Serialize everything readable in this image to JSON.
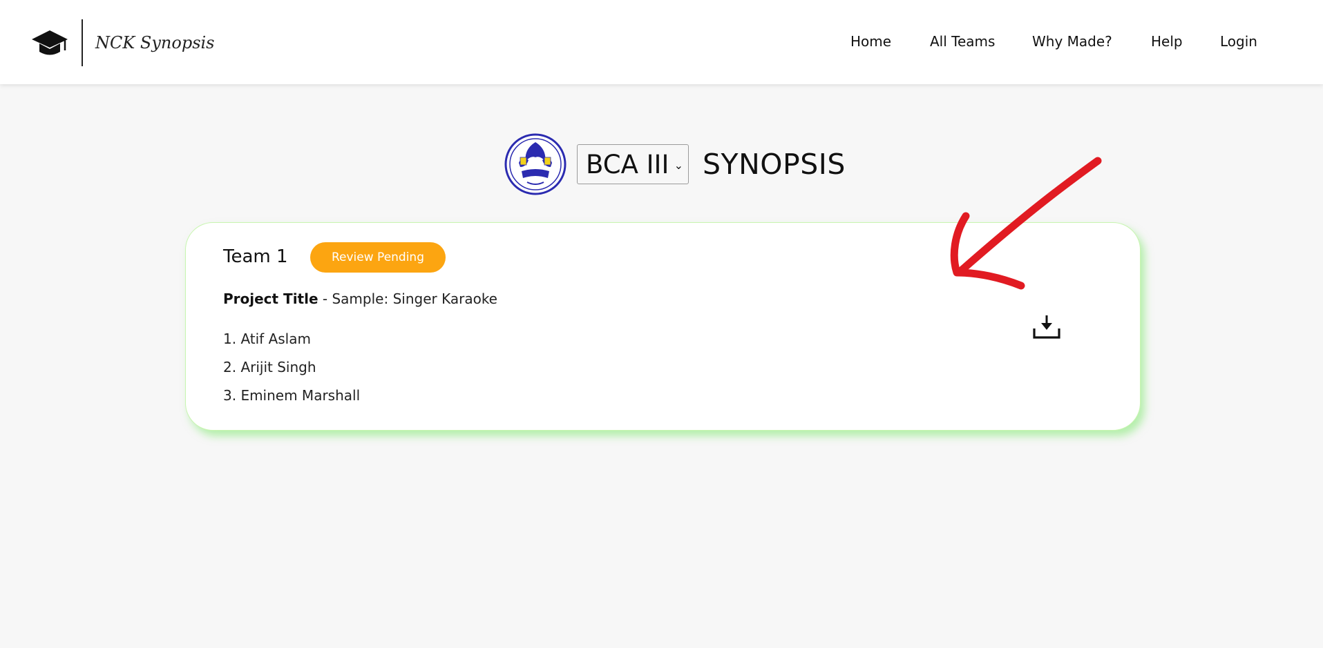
{
  "app": {
    "name": "NCK Synopsis"
  },
  "nav": {
    "items": [
      {
        "label": "Home"
      },
      {
        "label": "All Teams"
      },
      {
        "label": "Why Made?"
      },
      {
        "label": "Help"
      },
      {
        "label": "Login"
      }
    ]
  },
  "heading": {
    "class_select": {
      "selected": "BCA III"
    },
    "title": "SYNOPSIS"
  },
  "team": {
    "name": "Team 1",
    "status": "Review Pending",
    "status_color": "#fca511",
    "project_label": "Project Title",
    "project_separator": "-",
    "project_title": "Sample: Singer Karaoke",
    "members": [
      "1. Atif Aslam",
      "2. Arijit Singh",
      "3. Eminem Marshall"
    ]
  },
  "icons": {
    "brand": "graduation-cap-icon",
    "download": "download-icon",
    "annotation": "red-arrow-annotation"
  },
  "colors": {
    "accent_border": "#c8f5b0",
    "annotation": "#e11b22"
  }
}
